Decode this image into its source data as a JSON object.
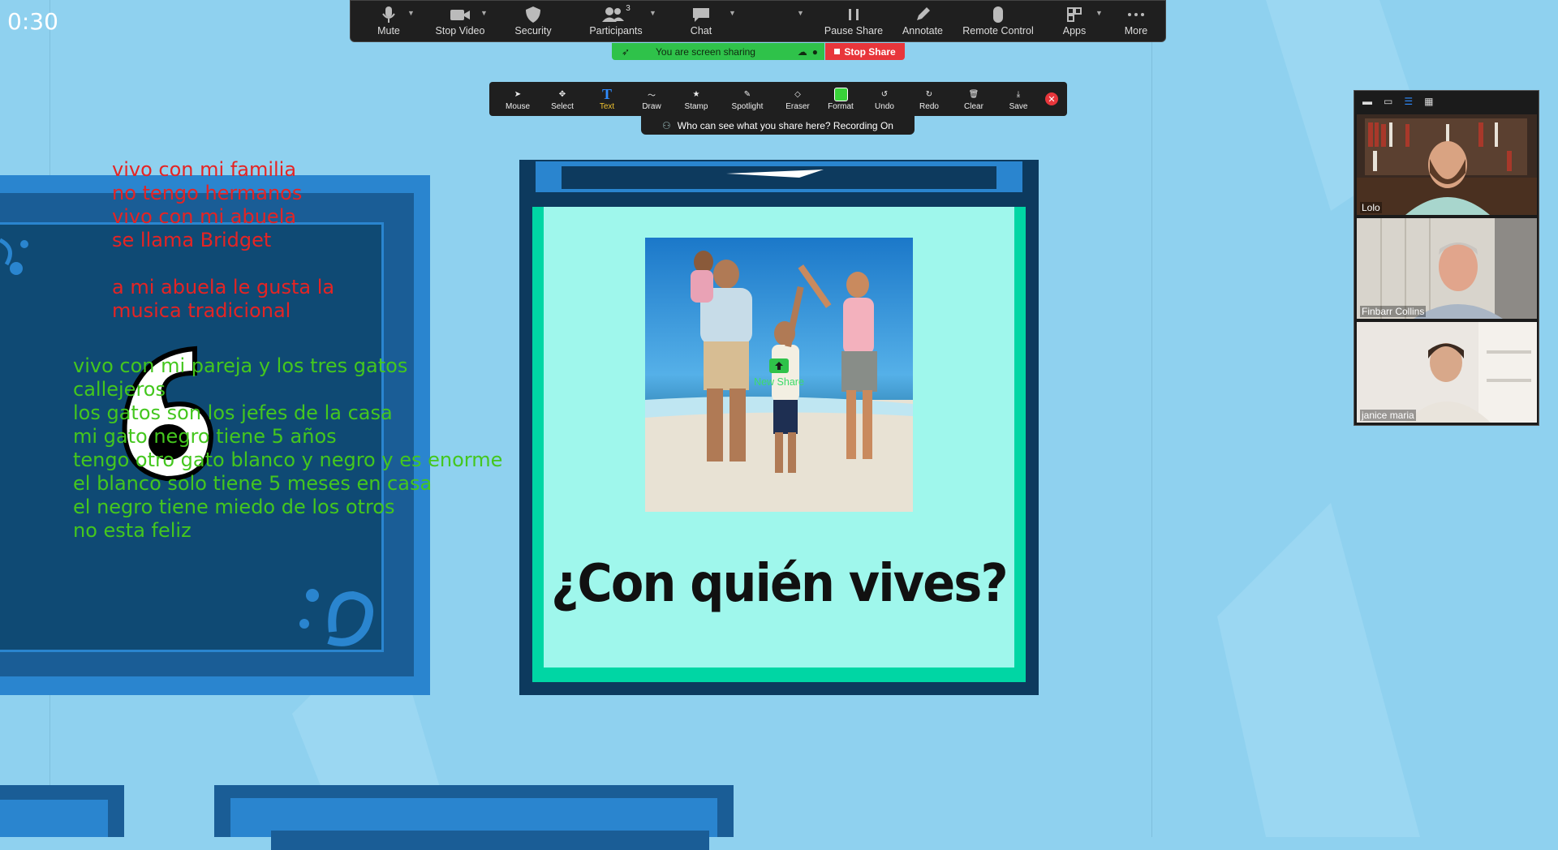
{
  "timer": "0:30",
  "toolbar": {
    "mute": "Mute",
    "stop_video": "Stop Video",
    "security": "Security",
    "participants": "Participants",
    "participants_count": "3",
    "chat": "Chat",
    "new_share": "New Share",
    "pause_share": "Pause Share",
    "annotate": "Annotate",
    "remote_control": "Remote Control",
    "apps": "Apps",
    "more": "More"
  },
  "share_status": {
    "sharing": "You are screen sharing",
    "stop": "Stop Share"
  },
  "annotate": {
    "tools": [
      "Mouse",
      "Select",
      "Text",
      "Draw",
      "Stamp",
      "Spotlight",
      "Eraser",
      "Format",
      "Undo",
      "Redo",
      "Clear",
      "Save"
    ],
    "active_tool": "Text",
    "recording_notice": "Who can see what you share here? Recording On"
  },
  "slide": {
    "heading": "¿Con quién vives?",
    "number": "6"
  },
  "notes": {
    "red": "vivo con mi familia\nno tengo hermanos\nvivo con mi abuela\nse llama Bridget\n\na mi abuela le gusta la\nmusica tradicional",
    "green": "vivo con mi pareja y los tres gatos\ncallejeros\nlos gatos son los jefes de la casa\nmi gato negro tiene 5 años\ntengo otro gato blanco y negro y es enorme\nel blanco solo tiene 5 meses en casa\nel negro tiene miedo de los otros\nno esta feliz"
  },
  "participants": [
    {
      "name": "Lolo"
    },
    {
      "name": "Finbarr Collins"
    },
    {
      "name": "janice maria"
    }
  ],
  "colors": {
    "accent_green": "#2fc24a",
    "stop_red": "#e8363b",
    "annotate_red": "#e52424",
    "annotate_green": "#44c71e"
  }
}
